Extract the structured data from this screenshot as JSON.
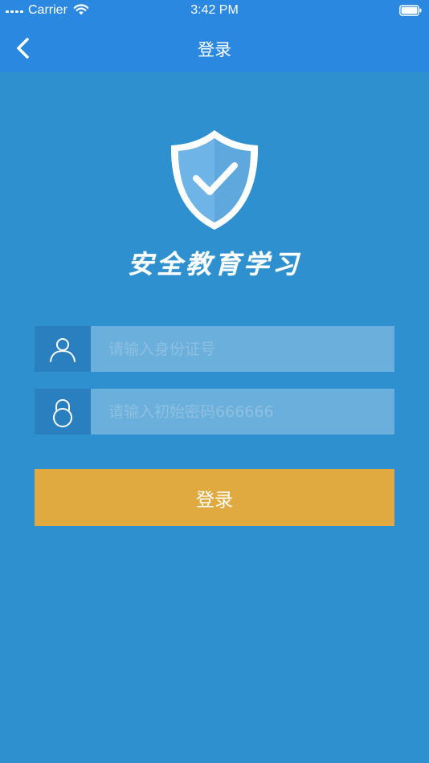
{
  "status_bar": {
    "carrier": "Carrier",
    "time": "3:42 PM"
  },
  "nav": {
    "title": "登录",
    "back_icon": "chevron-left-icon"
  },
  "logo": {
    "icon": "shield-check-icon",
    "app_name": "安全教育学习"
  },
  "form": {
    "id_field": {
      "icon": "user-icon",
      "placeholder": "请输入身份证号",
      "value": ""
    },
    "password_field": {
      "icon": "lock-icon",
      "placeholder": "请输入初始密码666666",
      "value": ""
    },
    "login_button_label": "登录"
  },
  "colors": {
    "background": "#2e90cf",
    "nav_bar": "#2b88e0",
    "icon_box": "#2a80bf",
    "input_background": "#6bb0dd",
    "login_button": "#e0aa40"
  }
}
